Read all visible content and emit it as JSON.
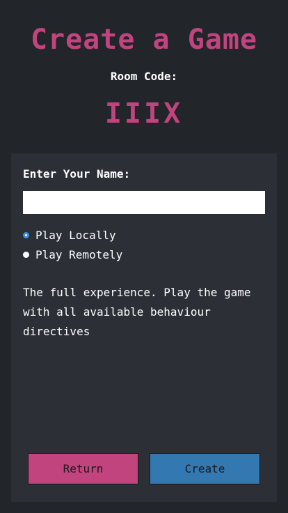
{
  "header": {
    "title": "Create a Game",
    "room_code_label": "Room Code:",
    "room_code": "IIIX"
  },
  "form": {
    "name_label": "Enter Your Name:",
    "name_value": "",
    "name_placeholder": "",
    "options": [
      {
        "label": "Play Locally",
        "selected": true
      },
      {
        "label": "Play Remotely",
        "selected": false
      }
    ],
    "description": "The full experience. Play the game with all available behaviour directives"
  },
  "buttons": {
    "return_label": "Return",
    "create_label": "Create"
  },
  "colors": {
    "accent_pink": "#c2447f",
    "accent_blue": "#3478b2",
    "background": "#22252a",
    "panel": "#2c2f36"
  }
}
